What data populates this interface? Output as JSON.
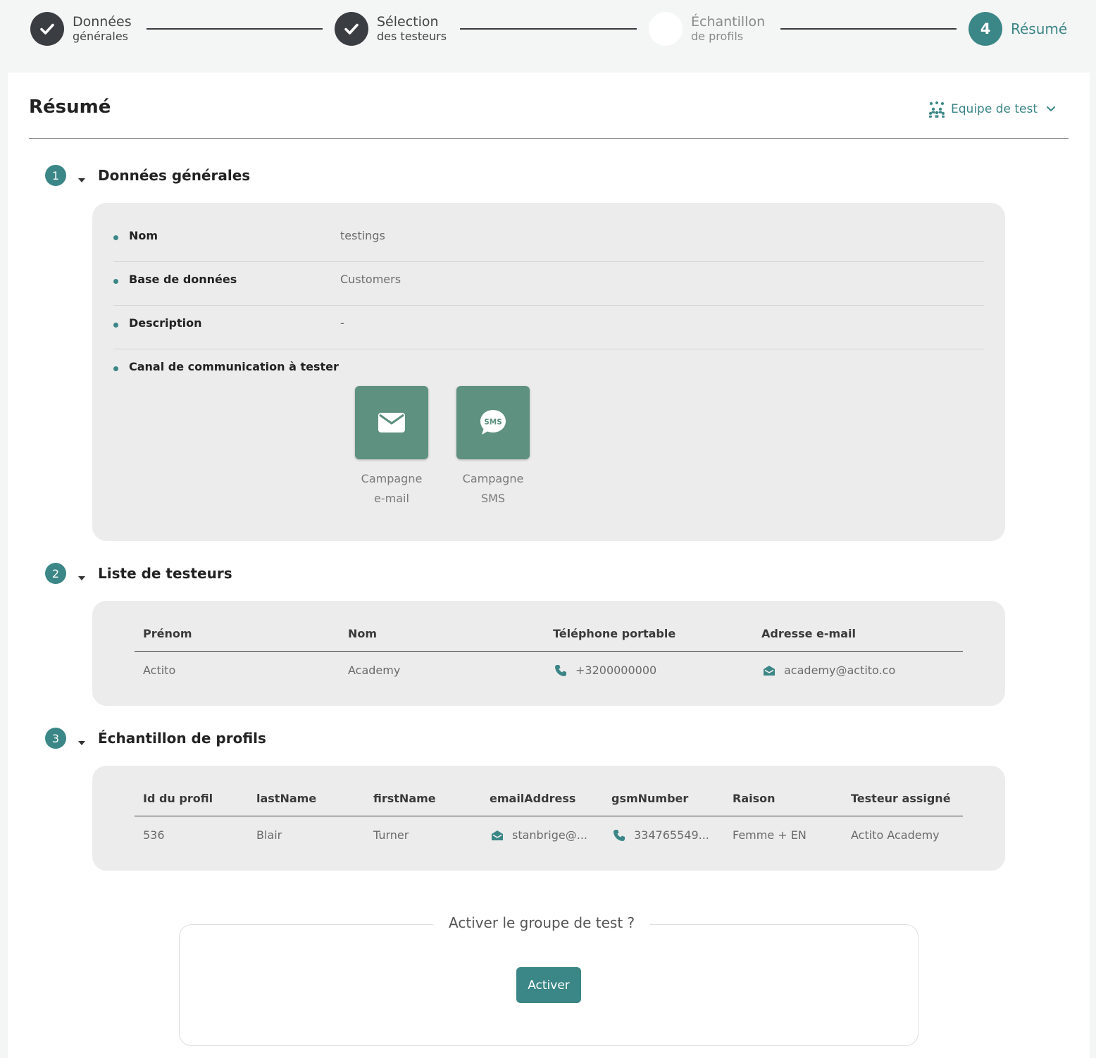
{
  "stepper": {
    "steps": [
      {
        "title": "Données",
        "subtitle": "générales",
        "state": "done"
      },
      {
        "title": "Sélection",
        "subtitle": "des testeurs",
        "state": "done"
      },
      {
        "title": "Échantillon",
        "subtitle": "de profils",
        "state": "pending"
      },
      {
        "number": "4",
        "title": "Résumé",
        "state": "active"
      }
    ]
  },
  "page": {
    "title": "Résumé",
    "team_dropdown": "Equipe de test"
  },
  "sections": [
    {
      "number": "1",
      "title": "Données générales"
    },
    {
      "number": "2",
      "title": "Liste de testeurs"
    },
    {
      "number": "3",
      "title": "Échantillon de profils"
    }
  ],
  "general": {
    "rows": [
      {
        "label": "Nom",
        "value": "testings"
      },
      {
        "label": "Base de données",
        "value": "Customers"
      },
      {
        "label": "Description",
        "value": "-"
      },
      {
        "label": "Canal de communication à tester",
        "value": ""
      }
    ],
    "channels": [
      {
        "label": "Campagne\ne-mail",
        "icon": "envelope-icon"
      },
      {
        "label": "Campagne\nSMS",
        "icon": "sms-bubble-icon",
        "badge": "SMS"
      }
    ]
  },
  "testers": {
    "headers": [
      "Prénom",
      "Nom",
      "Téléphone portable",
      "Adresse e-mail"
    ],
    "rows": [
      {
        "first": "Actito",
        "last": "Academy",
        "phone": "+3200000000",
        "email": "academy@actito.co"
      }
    ]
  },
  "profiles": {
    "headers": [
      "Id du profil",
      "lastName",
      "firstName",
      "emailAddress",
      "gsmNumber",
      "Raison",
      "Testeur assigné"
    ],
    "rows": [
      {
        "id": "536",
        "lastName": "Blair",
        "firstName": "Turner",
        "email": "stanbrige@...",
        "gsm": "334765549...",
        "reason": "Femme + EN",
        "tester": "Actito Academy"
      }
    ]
  },
  "activation": {
    "question": "Activer le groupe de test ?",
    "button": "Activer"
  },
  "colors": {
    "accent": "#3b8686",
    "channel_tile": "#5e917f",
    "step_done": "#3a3d41",
    "panel": "#ececec"
  }
}
